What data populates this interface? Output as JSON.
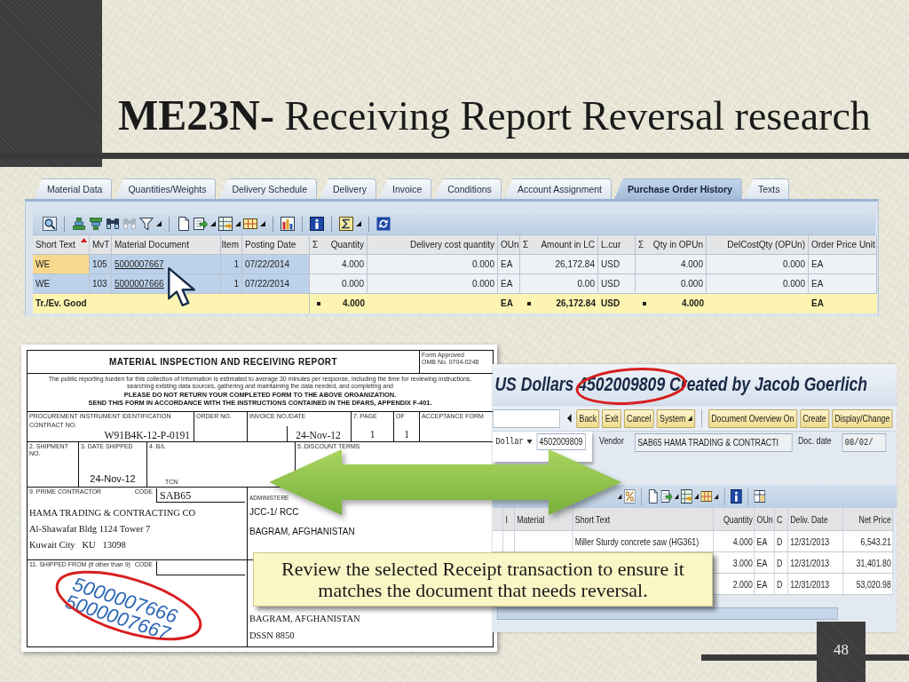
{
  "slide": {
    "title": "**ME23N-** Receiving Report Reversal research",
    "page_number": "48"
  },
  "po_history": {
    "tabs": [
      {
        "label": "Material Data",
        "selected": false
      },
      {
        "label": "Quantities/Weights",
        "selected": false
      },
      {
        "label": "Delivery Schedule",
        "selected": false
      },
      {
        "label": "Delivery",
        "selected": false
      },
      {
        "label": "Invoice",
        "selected": false
      },
      {
        "label": "Conditions",
        "selected": false
      },
      {
        "label": "Account Assignment",
        "selected": false
      },
      {
        "label": "Purchase Order History",
        "selected": true
      },
      {
        "label": "Texts",
        "selected": false
      }
    ],
    "columns": [
      {
        "label": "Short Text",
        "kind": "text",
        "key": true,
        "sorted": true
      },
      {
        "label": "MvT",
        "kind": "text",
        "key": true,
        "sorted": false
      },
      {
        "label": "Material Document",
        "kind": "link",
        "key": true,
        "sorted": false
      },
      {
        "label": "Item",
        "kind": "number",
        "key": true,
        "sorted": false
      },
      {
        "label": "Posting Date",
        "kind": "text",
        "key": true,
        "sorted": false
      },
      {
        "label": "Quantity",
        "sum_mark": "Σ",
        "kind": "number",
        "key": false,
        "sorted": false,
        "total": "4.000"
      },
      {
        "label": "Delivery cost quantity",
        "kind": "number",
        "key": false,
        "sorted": false
      },
      {
        "label": "OUn",
        "kind": "text",
        "key": false,
        "sorted": false,
        "total": "EA"
      },
      {
        "label": "Amount in LC",
        "sum_mark": "Σ",
        "kind": "number",
        "key": false,
        "sorted": false,
        "total": "26,172.84"
      },
      {
        "label": "L.cur",
        "kind": "text",
        "key": false,
        "sorted": false,
        "total": "USD"
      },
      {
        "label": "Qty in OPUn",
        "sum_mark": "Σ",
        "kind": "number",
        "key": false,
        "sorted": false,
        "total": "4.000"
      },
      {
        "label": "DelCostQty (OPUn)",
        "kind": "number",
        "key": false,
        "sorted": false
      },
      {
        "label": "Order Price Unit",
        "kind": "text",
        "key": false,
        "sorted": false,
        "total": "EA"
      }
    ],
    "rows": [
      {
        "focused": true,
        "cells": [
          "WE",
          "105",
          "5000007667",
          "1",
          "07/22/2014",
          "4.000",
          "0.000",
          "EA",
          "26,172.84",
          "USD",
          "4.000",
          "0.000",
          "EA"
        ]
      },
      {
        "focused": false,
        "cells": [
          "WE",
          "103",
          "5000007666",
          "1",
          "07/22/2014",
          "0.000",
          "0.000",
          "EA",
          "0.00",
          "USD",
          "0.000",
          "0.000",
          "EA"
        ]
      }
    ],
    "total_label": "Tr./Ev. Good"
  },
  "receiving_report": {
    "title": "MATERIAL INSPECTION AND RECEIVING REPORT",
    "approval": [
      "Form Approved",
      "OMB No. 0704-0248"
    ],
    "burden_notice": "The public reporting burden for this collection of information is estimated to average 30 minutes per response, including the time for reviewing instructions, searching existing data sources, gathering and maintaining the data needed, and completing and",
    "instructions": [
      "PLEASE DO NOT RETURN YOUR COMPLETED FORM TO THE ABOVE ORGANIZATION.",
      "SEND THIS FORM IN ACCORDANCE WITH THE INSTRUCTIONS CONTAINED IN THE DFARS, APPENDIX F-401."
    ],
    "procurement": {
      "label": "PROCUREMENT INSTRUMENT IDENTIFICATION",
      "sublabel": "CONTRACT NO.",
      "value": "W91B4K-12-P-0191"
    },
    "order_no": {
      "label": "ORDER NO."
    },
    "invoice": {
      "label": "INVOICE NO./DATE",
      "value": "24-Nov-12"
    },
    "page": {
      "label": "7. PAGE",
      "value": "1"
    },
    "page_of": {
      "label": "OF",
      "value": "1"
    },
    "acceptance": {
      "label": "ACCEPTANCE FORM"
    },
    "shipment_no": {
      "label": "2. SHIPMENT NO."
    },
    "date_shipped": {
      "label": "3. DATE SHIPPED",
      "value": "24-Nov-12"
    },
    "bill_of_lading": {
      "label": "4. B/L",
      "sublabel": "TCN"
    },
    "discount_terms": {
      "label": "5. DISCOUNT TERMS"
    },
    "prime_contractor": {
      "label": "9. PRIME CONTRACTOR",
      "code_label": "CODE",
      "code": "SAB65",
      "address": [
        "HAMA TRADING & CONTRACTING CO",
        "Al-Shawafat Bldg 1124 Tower 7",
        "Kuwait City   KU   13098"
      ]
    },
    "administered_by": {
      "label": "ADMINISTERE",
      "address": [
        "JCC-1/ RCC",
        "BAGRAM, AFGHANISTAN"
      ]
    },
    "shipped_from": {
      "label": "11. SHIPPED FROM (if other than 9)",
      "code_label": "CODE"
    },
    "lower_right_address": [
      "BAGRAM, AFGHANISTAN",
      "DSSN 8850"
    ],
    "stamp": [
      "5000007666",
      "5000007667"
    ]
  },
  "po_screen": {
    "title": "US Dollars 4502009809 Created by Jacob Goerlich",
    "buttons": [
      {
        "label": "Back",
        "menu": false,
        "separator_before": false
      },
      {
        "label": "Exit",
        "menu": false,
        "separator_before": false
      },
      {
        "label": "Cancel",
        "menu": false,
        "separator_before": false
      },
      {
        "label": "System",
        "menu": true,
        "separator_before": false
      },
      {
        "label": "Document Overview On",
        "menu": false,
        "separator_before": true
      },
      {
        "label": "Create",
        "menu": false,
        "separator_before": false
      },
      {
        "label": "Display/Change",
        "menu": false,
        "separator_before": false
      }
    ],
    "currency": "Dollar",
    "po_number": "4502009809",
    "vendor": {
      "label": "Vendor",
      "value": "SAB65 HAMA TRADING & CONTRACTI"
    },
    "doc_date": {
      "label": "Doc. date",
      "value": "08/02/"
    },
    "columns": [
      {
        "label": "I",
        "kind": "text"
      },
      {
        "label": "Material",
        "kind": "text"
      },
      {
        "label": "Short Text",
        "kind": "text"
      },
      {
        "label": "Quantity",
        "kind": "number"
      },
      {
        "label": "OUn",
        "kind": "text"
      },
      {
        "label": "C",
        "kind": "text"
      },
      {
        "label": "Deliv. Date",
        "kind": "text"
      },
      {
        "label": "Net Price",
        "kind": "number"
      }
    ],
    "items": [
      {
        "short_text": "Miller Sturdy concrete saw (HG361)",
        "quantity": "4.000",
        "unit": "EA",
        "c": "D",
        "delivery_date": "12/31/2013",
        "net_price": "6,543.21"
      },
      {
        "quantity": "3.000",
        "unit": "EA",
        "c": "D",
        "delivery_date": "12/31/2013",
        "net_price": "31,401.80"
      },
      {
        "quantity": "2.000",
        "unit": "EA",
        "c": "D",
        "delivery_date": "12/31/2013",
        "net_price": "53,020.98"
      }
    ]
  },
  "callout": {
    "text": "Review the selected Receipt transaction to ensure it matches the document that needs reversal."
  }
}
